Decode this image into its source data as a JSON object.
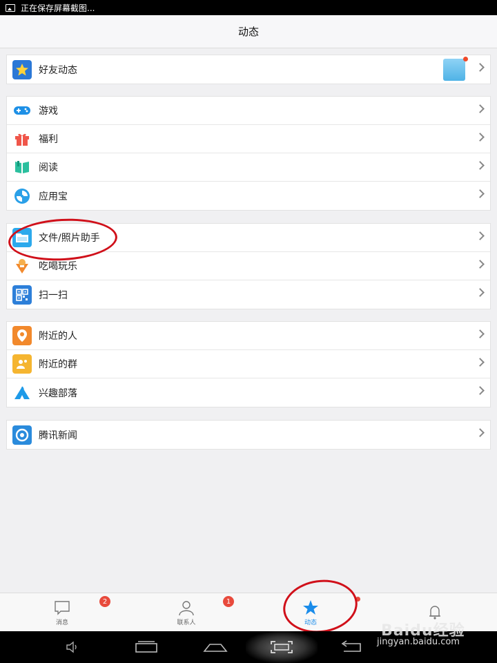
{
  "statusbar": {
    "text": "正在保存屏幕截图..."
  },
  "header": {
    "title": "动态"
  },
  "groups": [
    {
      "items": [
        {
          "label": "好友动态",
          "icon": "star-icon"
        }
      ]
    },
    {
      "items": [
        {
          "label": "游戏",
          "icon": "gamepad-icon"
        },
        {
          "label": "福利",
          "icon": "gift-icon"
        },
        {
          "label": "阅读",
          "icon": "book-icon"
        },
        {
          "label": "应用宝",
          "icon": "app-store-icon"
        }
      ]
    },
    {
      "items": [
        {
          "label": "文件/照片助手",
          "icon": "folder-icon"
        },
        {
          "label": "吃喝玩乐",
          "icon": "food-icon"
        },
        {
          "label": "扫一扫",
          "icon": "qrcode-icon"
        }
      ]
    },
    {
      "items": [
        {
          "label": "附近的人",
          "icon": "location-pin-icon"
        },
        {
          "label": "附近的群",
          "icon": "group-location-icon"
        },
        {
          "label": "兴趣部落",
          "icon": "tent-icon"
        }
      ]
    },
    {
      "items": [
        {
          "label": "腾讯新闻",
          "icon": "news-icon"
        }
      ]
    }
  ],
  "tabs": [
    {
      "label": "消息",
      "icon": "chat-icon",
      "badge": "2"
    },
    {
      "label": "联系人",
      "icon": "contact-icon",
      "badge": "1"
    },
    {
      "label": "动态",
      "icon": "star-icon",
      "active": true
    },
    {
      "label": "",
      "icon": "bell-icon"
    }
  ],
  "watermark": {
    "logo": "Baidu经验",
    "url": "jingyan.baidu.com"
  },
  "colors": {
    "accent": "#1a8cea",
    "badge": "#e84a3c",
    "annotation": "#d0101a"
  }
}
